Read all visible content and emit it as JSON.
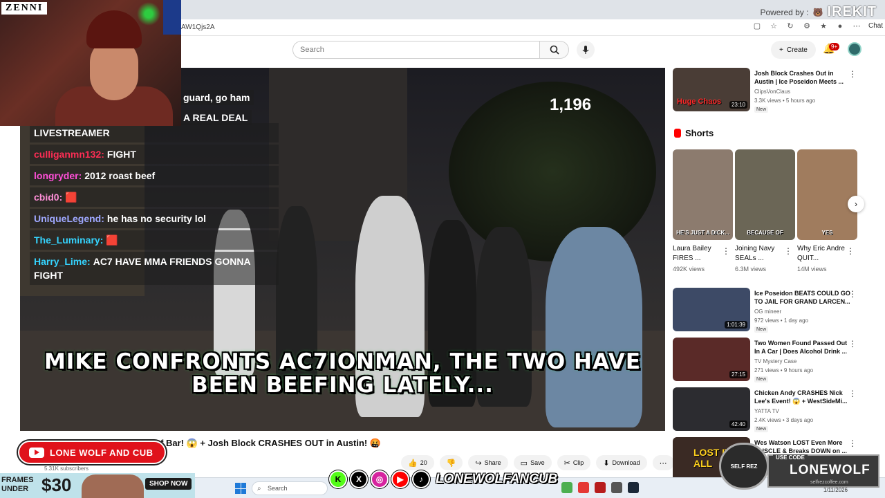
{
  "watermark": {
    "powered_by": "Powered by :",
    "brand": "IREKIT"
  },
  "browser": {
    "url_fragment": "AW1Qjs2A",
    "chat_label": "Chat"
  },
  "yt_header": {
    "search_placeholder": "Search",
    "create_label": "Create",
    "notifications_badge": "9+"
  },
  "webcam": {
    "sponsor_logo": "ZENNI"
  },
  "video": {
    "viewer_count": "1,196",
    "partial_chat_1": "guard, go ham",
    "partial_chat_2": "A REAL DEAL",
    "chat": [
      {
        "user": "",
        "text": "LIVESTREAMER",
        "color": "#ffffff"
      },
      {
        "user": "culliganmn132:",
        "text": "FIGHT",
        "color": "#ff2d55"
      },
      {
        "user": "longryder:",
        "text": "2012 roast beef",
        "color": "#ff4fd8"
      },
      {
        "user": "cbid0:",
        "text": "",
        "color": "#ff8fd8"
      },
      {
        "user": "UniqueLegend:",
        "text": "he has no security lol",
        "color": "#9fa8ff"
      },
      {
        "user": "The_Luminary:",
        "text": "",
        "color": "#35d4ff"
      },
      {
        "user": "Harry_Lime:",
        "text": "AC7 HAVE MMA FRIENDS GONNA FIGHT",
        "color": "#35d4ff"
      }
    ],
    "caption_line1": "MIKE CONFRONTS AC7IONMAN, THE TWO HAVE",
    "caption_line2": "BEEN BEEFING LATELY..."
  },
  "below_video": {
    "title_visible": "f Bar! 😱 + Josh Block CRASHES OUT in Austin! 🤬",
    "channel_badge": "LONE WOLF AND CUB",
    "subscribers": "5.31K subscribers",
    "actions": [
      {
        "icon": "👍",
        "label": "20",
        "name": "like-button"
      },
      {
        "icon": "👎",
        "label": "",
        "name": "dislike-button"
      },
      {
        "icon": "↪",
        "label": "Share",
        "name": "share-button"
      },
      {
        "icon": "▭",
        "label": "Save",
        "name": "save-button"
      },
      {
        "icon": "✂",
        "label": "Clip",
        "name": "clip-button"
      },
      {
        "icon": "⬇",
        "label": "Download",
        "name": "download-button"
      },
      {
        "icon": "⋯",
        "label": "",
        "name": "more-actions-button"
      }
    ]
  },
  "sidebar": {
    "top_video": {
      "title": "Josh Block Crashes Out in Austin | Ice Poseidon Meets ...",
      "channel": "ClipsVonClaus",
      "meta": "3.3K views • 5 hours ago",
      "badge": "New",
      "duration": "23:10",
      "thumb_text": "Huge Chaos"
    },
    "shorts_title": "Shorts",
    "shorts": [
      {
        "title": "Laura Bailey FIRES ...",
        "views": "492K views",
        "overlay": "HE'S JUST A DICK...",
        "color": "#8c7b6e"
      },
      {
        "title": "Joining Navy SEALs ...",
        "views": "6.3M views",
        "overlay": "BECAUSE OF",
        "color": "#6b6656"
      },
      {
        "title": "Why Eric Andre QUIT...",
        "views": "14M views",
        "overlay": "YES",
        "color": "#a07c5e"
      }
    ],
    "videos": [
      {
        "title": "Ice Poseidon BEATS COULD GO TO JAIL FOR GRAND LARCEN...",
        "channel": "OG mineer",
        "meta": "972 views • 1 day ago",
        "badge": "New",
        "duration": "1:01:39",
        "color": "#3d4a66"
      },
      {
        "title": "Two Women Found Passed Out In A Car | Does Alcohol Drink ...",
        "channel": "TV Mystery Case",
        "meta": "271 views • 9 hours ago",
        "badge": "New",
        "duration": "27:15",
        "color": "#5a2a28"
      },
      {
        "title": "Chicken Andy CRASHES Nick Lee's Event! 😱 + WestSideMi...",
        "channel": "YATTA TV",
        "meta": "2.4K views • 3 days ago",
        "badge": "New",
        "duration": "42:40",
        "color": "#2c2c30"
      },
      {
        "title": "Wes Watson LOST Even More MUSCLE & Breaks DOWN on ...",
        "channel": "",
        "meta": "",
        "badge": "",
        "duration": "",
        "color": "#3a2a24",
        "thumb_text": "LOST IT ALL"
      }
    ]
  },
  "overlays": {
    "zenni_frames": "FRAMES UNDER",
    "zenni_price": "$30",
    "zenni_shop": "SHOP NOW",
    "social_handle": "LONEWOLFANCUB",
    "selfrez": "SELF REZ",
    "use_code_label": "USE CODE",
    "code": "LONEWOLF",
    "code_site": "selfrezcoffee.com"
  },
  "taskbar": {
    "search_placeholder": "Search",
    "date": "1/11/2026"
  }
}
